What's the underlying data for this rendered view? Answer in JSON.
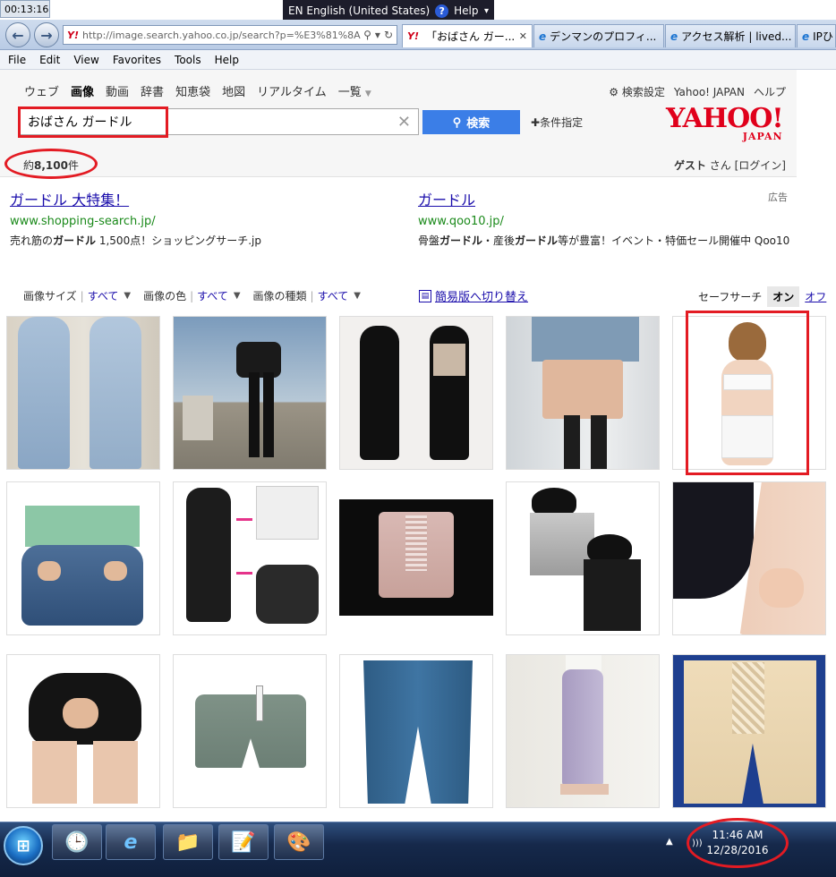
{
  "timer": "00:13:16",
  "langbar": {
    "language": "EN English (United States)",
    "help": "Help"
  },
  "browser": {
    "url": "http://image.search.yahoo.co.jp/search?p=%E3%81%8A",
    "tabs": [
      {
        "label": "「おばさん ガー...",
        "icon": "yahoo-favicon",
        "active": true
      },
      {
        "label": "デンマンのプロフィ...",
        "icon": "ie-icon"
      },
      {
        "label": "アクセス解析 | lived...",
        "icon": "ie-icon"
      },
      {
        "label": "IPひ",
        "icon": "ie-icon"
      }
    ],
    "menu": [
      "File",
      "Edit",
      "View",
      "Favorites",
      "Tools",
      "Help"
    ]
  },
  "yahoo": {
    "nav": [
      {
        "label": "ウェブ"
      },
      {
        "label": "画像",
        "active": true
      },
      {
        "label": "動画"
      },
      {
        "label": "辞書"
      },
      {
        "label": "知恵袋"
      },
      {
        "label": "地図"
      },
      {
        "label": "リアルタイム"
      },
      {
        "label": "一覧"
      }
    ],
    "settings": "検索設定",
    "yahoo_japan": "Yahoo! JAPAN",
    "help": "ヘルプ",
    "query": "おばさん ガードル",
    "search_button": "検索",
    "conditions": "条件指定",
    "logo": "YAHOO!",
    "logo_sub": "JAPAN",
    "count_prefix": "約",
    "count": "8,100",
    "count_suffix": "件",
    "guest_name": "ゲスト",
    "guest_suffix": "さん",
    "login": "[ログイン]"
  },
  "ads": {
    "label": "広告",
    "items": [
      {
        "title": "ガードル 大特集！",
        "url": "www.shopping-search.jp/",
        "desc_parts": [
          "売れ筋の",
          "ガードル",
          " 1,500点！ショッピングサーチ.jp"
        ]
      },
      {
        "title": "ガードル",
        "url": "www.qoo10.jp/",
        "desc_parts": [
          "骨盤",
          "ガードル",
          "・産後",
          "ガードル",
          "等が豊富！イベント・特価セール開催中 Qoo10"
        ]
      }
    ]
  },
  "filters": {
    "size_label": "画像サイズ",
    "size_value": "すべて",
    "color_label": "画像の色",
    "color_value": "すべて",
    "type_label": "画像の種類",
    "type_value": "すべて",
    "simple_view": "簡易版へ切り替え",
    "safesearch_label": "セーフサーチ",
    "safesearch_on": "オン",
    "safesearch_off": "オフ"
  },
  "images": [
    "jeans-rear-view",
    "woman-bending-boots",
    "black-bodysuit-front-back",
    "beige-girdle-held",
    "woman-white-lingerie",
    "jeans-hands-back-pockets",
    "black-tights-diagram",
    "pink-lace-girdle",
    "grey-black-long-girdles",
    "black-shaping-tights-closeup",
    "black-shorts-rear",
    "grey-boxer-shorts",
    "blue-long-girdle",
    "lavender-slim-pants",
    "beige-lace-long-girdle"
  ],
  "taskbar": {
    "time": "11:46 AM",
    "date": "12/28/2016"
  },
  "colors": {
    "yahoo_red": "#e0001b",
    "search_blue": "#3b7ee7",
    "annotation_red": "#e31b23",
    "link_blue": "#1a0dab",
    "url_green": "#1b8a1b"
  }
}
